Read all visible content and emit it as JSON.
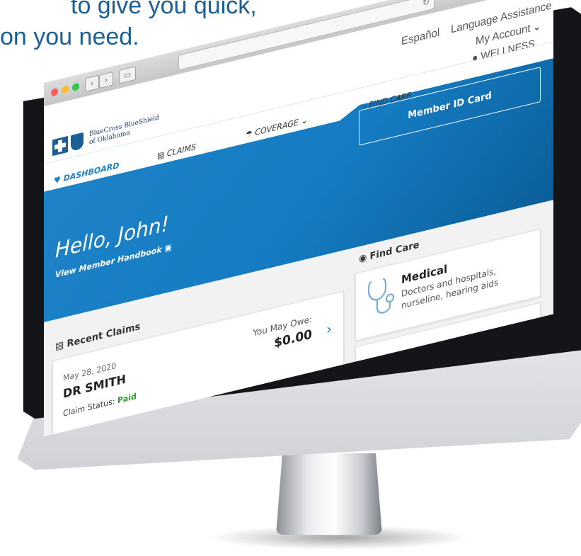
{
  "tagline": {
    "line1": "to give you quick,",
    "line2": "on you need."
  },
  "colors": {
    "brand_blue": "#1f83c8",
    "dark_blue": "#1a5f95",
    "paid_green": "#2e9e2e"
  },
  "browser": {
    "reload_icon": "↻"
  },
  "brand": {
    "name_line1": "BlueCross BlueShield",
    "name_line2": "of Oklahoma"
  },
  "util": {
    "espanol": "Español",
    "language_assistance": "Language Assistance",
    "my_account": "My Account",
    "wellness": "WELLNESS"
  },
  "nav": {
    "dashboard": "DASHBOARD",
    "claims": "CLAIMS",
    "coverage": "COVERAGE",
    "find_care": "FIND CARE"
  },
  "hero": {
    "greeting": "Hello, John!",
    "handbook_link": "View Member Handbook",
    "id_card_button": "Member ID Card"
  },
  "recent_claims": {
    "title": "Recent Claims",
    "claim": {
      "date": "May 28, 2020",
      "provider": "DR SMITH",
      "status_label": "Claim Status:",
      "status": "Paid",
      "owe_label": "You May Owe:",
      "owe_amount": "$0.00"
    }
  },
  "find_care": {
    "title": "Find Care",
    "medical": {
      "title": "Medical",
      "description": "Doctors and hospitals, nurseline, hearing aids"
    }
  }
}
